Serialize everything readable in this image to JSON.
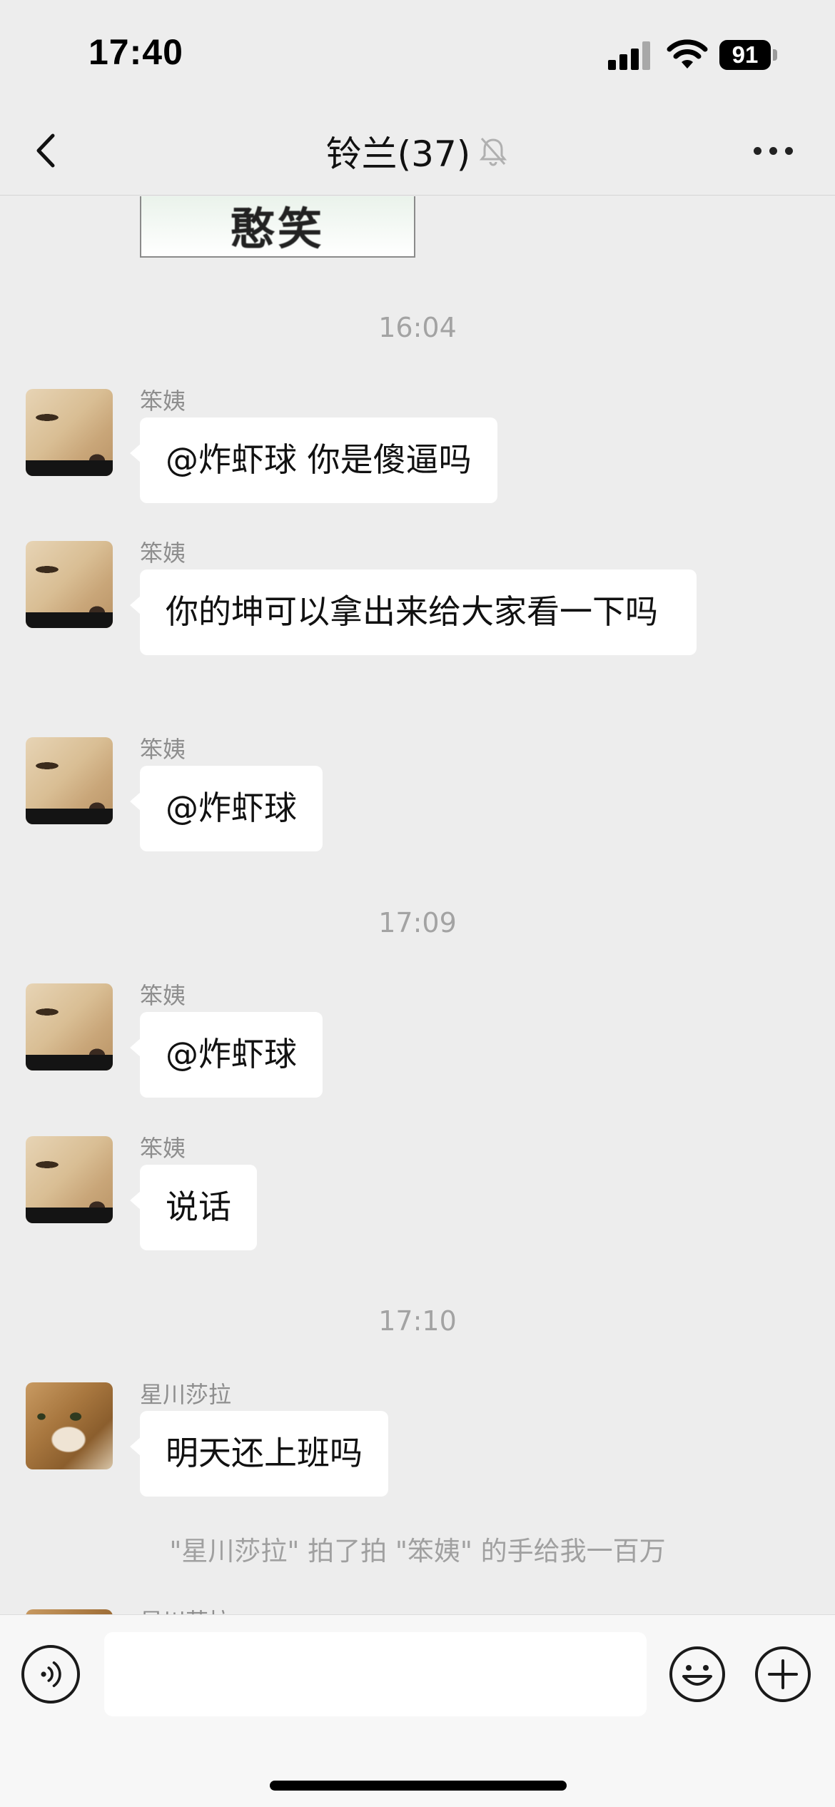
{
  "status_bar": {
    "time": "17:40",
    "battery": "91",
    "icons": [
      "signal-icon",
      "wifi-icon",
      "battery-icon"
    ]
  },
  "nav": {
    "title": "铃兰(37)",
    "icons": [
      "back-icon",
      "mute-bell-icon",
      "more-icon"
    ]
  },
  "chat": {
    "sticker_text": "憨笑",
    "time_dividers": [
      "16:04",
      "17:09",
      "17:10"
    ],
    "messages": [
      {
        "sender": "笨姨",
        "text": "@炸虾球 你是傻逼吗",
        "avatar": "dog-avatar"
      },
      {
        "sender": "笨姨",
        "text": "你的坤可以拿出来给大家看一下吗",
        "avatar": "dog-avatar"
      },
      {
        "sender": "笨姨",
        "text": "@炸虾球",
        "avatar": "dog-avatar"
      },
      {
        "sender": "笨姨",
        "text": "@炸虾球",
        "avatar": "dog-avatar"
      },
      {
        "sender": "笨姨",
        "text": "说话",
        "avatar": "dog-avatar"
      },
      {
        "sender": "星川莎拉",
        "text": "明天还上班吗",
        "avatar": "cat-avatar"
      }
    ],
    "pat_notice": "\"星川莎拉\" 拍了拍 \"笨姨\" 的手给我一百万",
    "partial_sender": "星川莎拉"
  },
  "input_bar": {
    "value": "",
    "icons": [
      "voice-icon",
      "emoji-icon",
      "plus-icon"
    ]
  }
}
